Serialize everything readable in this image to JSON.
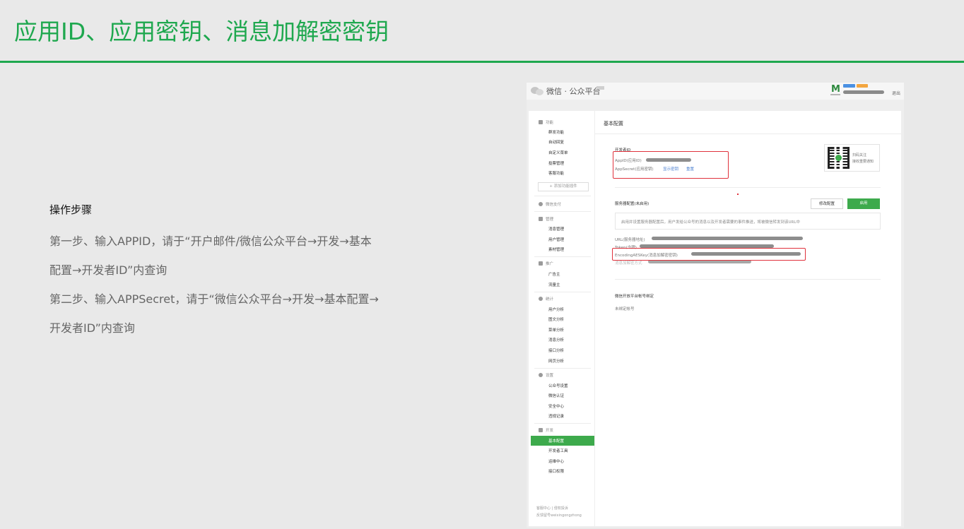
{
  "slide": {
    "title": "应用ID、应用密钥、消息加解密密钥",
    "accent_color": "#1fa84f"
  },
  "steps": {
    "heading": "操作步骤",
    "lines": [
      "第一步、输入APPID，请于“开户邮件/微信公众平台→开发→基本",
      "配置→开发者ID”内查询",
      "第二步、输入APPSecret，请于“微信公众平台→开发→基本配置→",
      "开发者ID”内查询"
    ]
  },
  "screenshot": {
    "topbar": {
      "platform_title": "微信 · 公众平台",
      "logo_icon": "wechat-logo-icon",
      "logout": "退出"
    },
    "sidebar": {
      "sections": [
        {
          "label": "功能",
          "icon": "grid-icon",
          "items": [
            "群发功能",
            "自动回复",
            "自定义菜单",
            "投票管理",
            "客服功能"
          ]
        },
        {
          "label": "微信支付",
          "icon": "pay-icon",
          "items": []
        },
        {
          "label": "管理",
          "icon": "manage-icon",
          "items": [
            "消息管理",
            "用户管理",
            "素材管理"
          ]
        },
        {
          "label": "推广",
          "icon": "promote-icon",
          "items": [
            "广告主",
            "流量主"
          ]
        },
        {
          "label": "统计",
          "icon": "stats-icon",
          "items": [
            "用户分析",
            "图文分析",
            "菜单分析",
            "消息分析",
            "接口分析",
            "网页分析"
          ]
        },
        {
          "label": "设置",
          "icon": "settings-icon",
          "items": [
            "公众号设置",
            "微信认证",
            "安全中心",
            "违规记录"
          ]
        },
        {
          "label": "开发",
          "icon": "dev-icon",
          "items": [
            "基本配置",
            "开发者工具",
            "运维中心",
            "接口权限"
          ]
        }
      ],
      "add_plugin": "+ 添加功能插件",
      "active_item": "基本配置",
      "footer_line1": "客服中心 | 侵权投诉",
      "footer_line2": "反馈留号weixingongzhong"
    },
    "content": {
      "page_title": "基本配置",
      "developer_id": {
        "heading": "开发者ID",
        "appid_label": "AppID(应用ID)",
        "appsecret_label": "AppSecret(应用密钥)",
        "show_key_link": "显示密钥",
        "reset_link": "重置"
      },
      "qr": {
        "line1": "扫码关注",
        "line2": "接收重要通知"
      },
      "server_config": {
        "heading": "服务器配置(未启用)",
        "modify_button": "修改配置",
        "enable_button": "启用",
        "notice": "启用并设置服务器配置后，用户发给公众号的消息以及开发者需要的事件推送，将被微信转发到该URL中",
        "url_label": "URL(服务器地址)",
        "token_label": "Token(令牌)",
        "aeskey_label": "EncodingAESKey(消息加解密密钥)",
        "encrypt_label": "消息加解密方式"
      },
      "open_platform": {
        "heading": "微信开放平台帐号绑定",
        "status": "未绑定帐号"
      }
    },
    "highlight_color": "#e0323c",
    "wechat_green": "#3daa4c"
  }
}
